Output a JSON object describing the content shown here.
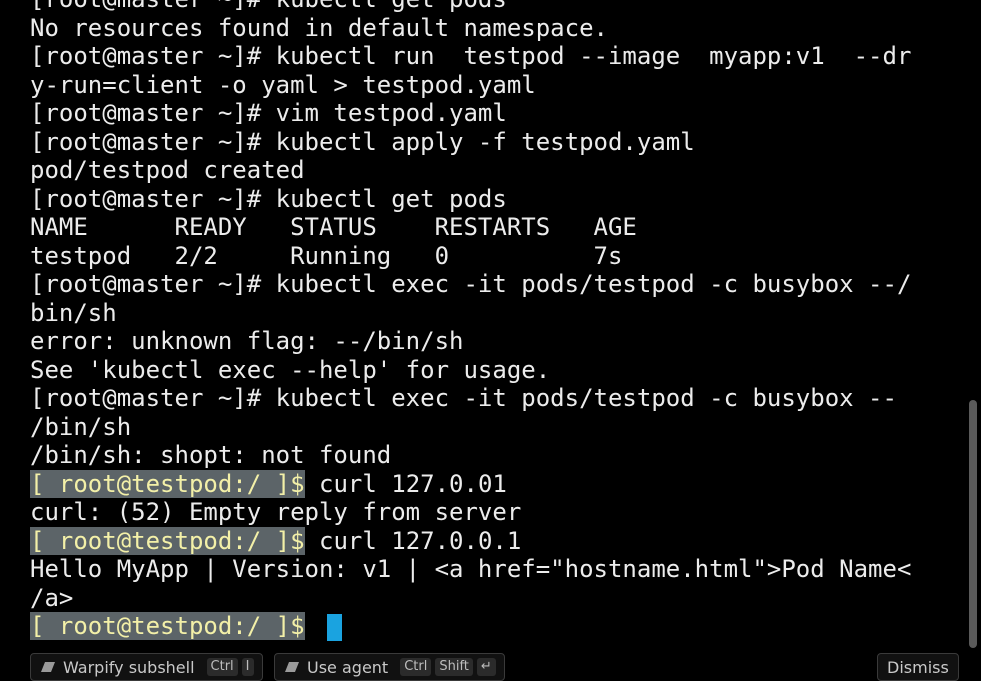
{
  "terminal": {
    "lines": [
      {
        "text": "[root@master ~]# kubectl get pods"
      },
      {
        "text": "No resources found in default namespace."
      },
      {
        "text": "[root@master ~]# kubectl run  testpod --image  myapp:v1  --dr"
      },
      {
        "text": "y-run=client -o yaml > testpod.yaml"
      },
      {
        "text": "[root@master ~]# vim testpod.yaml"
      },
      {
        "text": "[root@master ~]# kubectl apply -f testpod.yaml"
      },
      {
        "text": "pod/testpod created"
      },
      {
        "text": "[root@master ~]# kubectl get pods"
      },
      {
        "text": "NAME      READY   STATUS    RESTARTS   AGE"
      },
      {
        "text": "testpod   2/2     Running   0          7s"
      },
      {
        "text": "[root@master ~]# kubectl exec -it pods/testpod -c busybox --/"
      },
      {
        "text": "bin/sh"
      },
      {
        "text": "error: unknown flag: --/bin/sh"
      },
      {
        "text": "See 'kubectl exec --help' for usage."
      },
      {
        "text": "[root@master ~]# kubectl exec -it pods/testpod -c busybox --"
      },
      {
        "text": "/bin/sh"
      },
      {
        "text": "/bin/sh: shopt: not found"
      },
      {
        "prompt": "[ root@testpod:/ ]$",
        "text": " curl 127.0.01"
      },
      {
        "text": "curl: (52) Empty reply from server"
      },
      {
        "prompt": "[ root@testpod:/ ]$",
        "text": " curl 127.0.0.1"
      },
      {
        "text": "Hello MyApp | Version: v1 | <a href=\"hostname.html\">Pod Name<"
      },
      {
        "text": "/a>"
      },
      {
        "prompt": "[ root@testpod:/ ]$",
        "text": " ",
        "cursor": true
      }
    ]
  },
  "footer": {
    "warpify": {
      "label": "Warpify subshell",
      "keys": [
        "Ctrl",
        "I"
      ],
      "icon": "subshell-icon"
    },
    "agent": {
      "label": "Use agent",
      "keys": [
        "Ctrl",
        "Shift",
        "↵"
      ],
      "icon": "agent-icon"
    },
    "dismiss": {
      "label": "Dismiss"
    }
  },
  "colors": {
    "background": "#000000",
    "text": "#ececec",
    "prompt_highlight_bg": "#5c6468",
    "prompt_text": "#f3f0a8",
    "cursor": "#1aa3e0"
  }
}
